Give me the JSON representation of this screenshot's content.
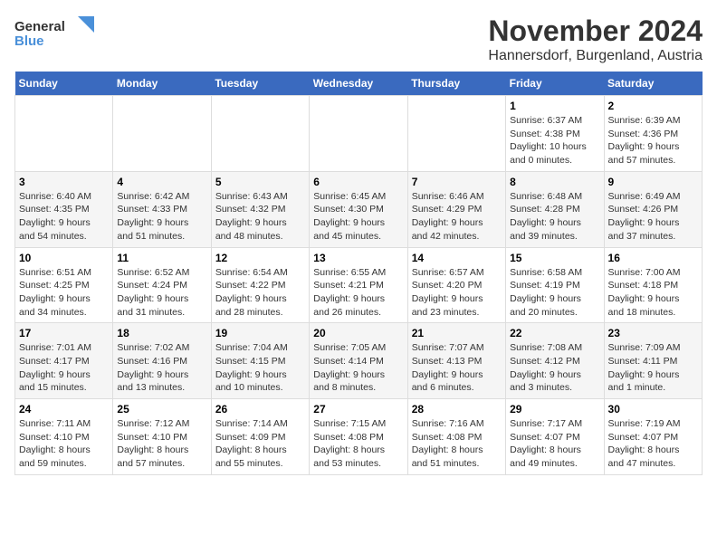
{
  "logo": {
    "line1": "General",
    "line2": "Blue"
  },
  "title": "November 2024",
  "subtitle": "Hannersdorf, Burgenland, Austria",
  "headers": [
    "Sunday",
    "Monday",
    "Tuesday",
    "Wednesday",
    "Thursday",
    "Friday",
    "Saturday"
  ],
  "weeks": [
    [
      {
        "day": "",
        "info": ""
      },
      {
        "day": "",
        "info": ""
      },
      {
        "day": "",
        "info": ""
      },
      {
        "day": "",
        "info": ""
      },
      {
        "day": "",
        "info": ""
      },
      {
        "day": "1",
        "info": "Sunrise: 6:37 AM\nSunset: 4:38 PM\nDaylight: 10 hours\nand 0 minutes."
      },
      {
        "day": "2",
        "info": "Sunrise: 6:39 AM\nSunset: 4:36 PM\nDaylight: 9 hours\nand 57 minutes."
      }
    ],
    [
      {
        "day": "3",
        "info": "Sunrise: 6:40 AM\nSunset: 4:35 PM\nDaylight: 9 hours\nand 54 minutes."
      },
      {
        "day": "4",
        "info": "Sunrise: 6:42 AM\nSunset: 4:33 PM\nDaylight: 9 hours\nand 51 minutes."
      },
      {
        "day": "5",
        "info": "Sunrise: 6:43 AM\nSunset: 4:32 PM\nDaylight: 9 hours\nand 48 minutes."
      },
      {
        "day": "6",
        "info": "Sunrise: 6:45 AM\nSunset: 4:30 PM\nDaylight: 9 hours\nand 45 minutes."
      },
      {
        "day": "7",
        "info": "Sunrise: 6:46 AM\nSunset: 4:29 PM\nDaylight: 9 hours\nand 42 minutes."
      },
      {
        "day": "8",
        "info": "Sunrise: 6:48 AM\nSunset: 4:28 PM\nDaylight: 9 hours\nand 39 minutes."
      },
      {
        "day": "9",
        "info": "Sunrise: 6:49 AM\nSunset: 4:26 PM\nDaylight: 9 hours\nand 37 minutes."
      }
    ],
    [
      {
        "day": "10",
        "info": "Sunrise: 6:51 AM\nSunset: 4:25 PM\nDaylight: 9 hours\nand 34 minutes."
      },
      {
        "day": "11",
        "info": "Sunrise: 6:52 AM\nSunset: 4:24 PM\nDaylight: 9 hours\nand 31 minutes."
      },
      {
        "day": "12",
        "info": "Sunrise: 6:54 AM\nSunset: 4:22 PM\nDaylight: 9 hours\nand 28 minutes."
      },
      {
        "day": "13",
        "info": "Sunrise: 6:55 AM\nSunset: 4:21 PM\nDaylight: 9 hours\nand 26 minutes."
      },
      {
        "day": "14",
        "info": "Sunrise: 6:57 AM\nSunset: 4:20 PM\nDaylight: 9 hours\nand 23 minutes."
      },
      {
        "day": "15",
        "info": "Sunrise: 6:58 AM\nSunset: 4:19 PM\nDaylight: 9 hours\nand 20 minutes."
      },
      {
        "day": "16",
        "info": "Sunrise: 7:00 AM\nSunset: 4:18 PM\nDaylight: 9 hours\nand 18 minutes."
      }
    ],
    [
      {
        "day": "17",
        "info": "Sunrise: 7:01 AM\nSunset: 4:17 PM\nDaylight: 9 hours\nand 15 minutes."
      },
      {
        "day": "18",
        "info": "Sunrise: 7:02 AM\nSunset: 4:16 PM\nDaylight: 9 hours\nand 13 minutes."
      },
      {
        "day": "19",
        "info": "Sunrise: 7:04 AM\nSunset: 4:15 PM\nDaylight: 9 hours\nand 10 minutes."
      },
      {
        "day": "20",
        "info": "Sunrise: 7:05 AM\nSunset: 4:14 PM\nDaylight: 9 hours\nand 8 minutes."
      },
      {
        "day": "21",
        "info": "Sunrise: 7:07 AM\nSunset: 4:13 PM\nDaylight: 9 hours\nand 6 minutes."
      },
      {
        "day": "22",
        "info": "Sunrise: 7:08 AM\nSunset: 4:12 PM\nDaylight: 9 hours\nand 3 minutes."
      },
      {
        "day": "23",
        "info": "Sunrise: 7:09 AM\nSunset: 4:11 PM\nDaylight: 9 hours\nand 1 minute."
      }
    ],
    [
      {
        "day": "24",
        "info": "Sunrise: 7:11 AM\nSunset: 4:10 PM\nDaylight: 8 hours\nand 59 minutes."
      },
      {
        "day": "25",
        "info": "Sunrise: 7:12 AM\nSunset: 4:10 PM\nDaylight: 8 hours\nand 57 minutes."
      },
      {
        "day": "26",
        "info": "Sunrise: 7:14 AM\nSunset: 4:09 PM\nDaylight: 8 hours\nand 55 minutes."
      },
      {
        "day": "27",
        "info": "Sunrise: 7:15 AM\nSunset: 4:08 PM\nDaylight: 8 hours\nand 53 minutes."
      },
      {
        "day": "28",
        "info": "Sunrise: 7:16 AM\nSunset: 4:08 PM\nDaylight: 8 hours\nand 51 minutes."
      },
      {
        "day": "29",
        "info": "Sunrise: 7:17 AM\nSunset: 4:07 PM\nDaylight: 8 hours\nand 49 minutes."
      },
      {
        "day": "30",
        "info": "Sunrise: 7:19 AM\nSunset: 4:07 PM\nDaylight: 8 hours\nand 47 minutes."
      }
    ]
  ]
}
